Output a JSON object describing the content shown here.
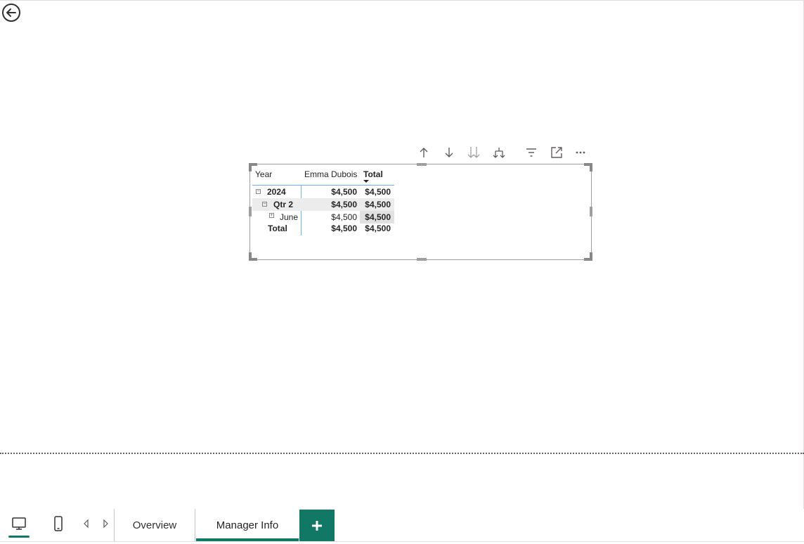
{
  "matrix": {
    "headers": {
      "year": "Year",
      "employee": "Emma Dubois",
      "total": "Total"
    },
    "rows": [
      {
        "label": "2024",
        "employee": "$4,500",
        "total": "$4,500",
        "expander": "−"
      },
      {
        "label": "Qtr 2",
        "employee": "$4,500",
        "total": "$4,500",
        "expander": "−"
      },
      {
        "label": "June",
        "employee": "$4,500",
        "total": "$4,500",
        "expander": "+"
      },
      {
        "label": "Total",
        "employee": "$4,500",
        "total": "$4,500"
      }
    ]
  },
  "toolbar": {
    "icons": [
      "arrow-up-icon",
      "arrow-down-icon",
      "double-arrow-down-icon",
      "expand-hierarchy-icon",
      "filter-icon",
      "focus-mode-icon",
      "more-options-icon"
    ]
  },
  "pages": {
    "tabs": [
      {
        "label": "Overview",
        "active": false
      },
      {
        "label": "Manager Info",
        "active": true
      }
    ],
    "add_label": "+"
  },
  "colors": {
    "accent": "#117865",
    "matrix_line": "#6ab1ef",
    "highlight": "#ececec"
  }
}
